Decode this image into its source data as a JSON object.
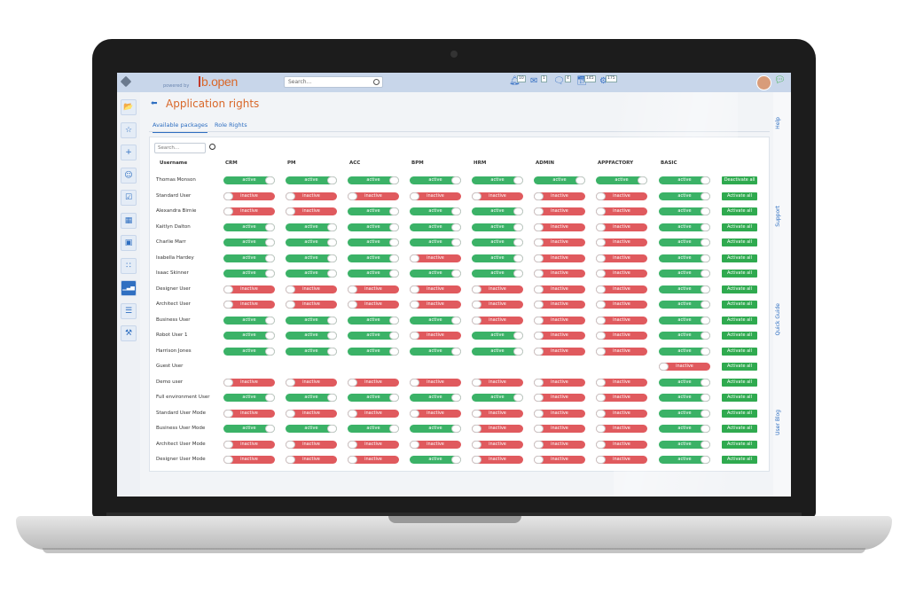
{
  "app": {
    "powered_by": "powered by",
    "brand": "b.open",
    "search_placeholder": "Search...",
    "badges": [
      "10",
      "1",
      "4",
      "145",
      "175"
    ]
  },
  "sidebar": {
    "icons": [
      "folder-icon",
      "star-icon",
      "plus-icon",
      "users-icon",
      "checkbox-icon",
      "grid-icon",
      "modules-icon",
      "apps-icon",
      "chart-icon",
      "org-chart-icon",
      "tools-icon"
    ],
    "active_index": 8
  },
  "page": {
    "back_label": "🡐",
    "title": "Application rights",
    "tabs": [
      "Available packages",
      "Role Rights"
    ],
    "user_search_placeholder": "Search..."
  },
  "table": {
    "username_header": "Username",
    "columns": [
      "CRM",
      "PM",
      "ACC",
      "BPM",
      "HRM",
      "ADMIN",
      "APPFACTORY",
      "BASIC"
    ],
    "on_label": "active",
    "off_label": "inactive",
    "rows": [
      {
        "user": "Thomas Monson",
        "states": [
          1,
          1,
          1,
          1,
          1,
          1,
          1,
          1
        ],
        "action": "Deactivate all"
      },
      {
        "user": "Standard User",
        "states": [
          0,
          0,
          0,
          0,
          0,
          0,
          0,
          1
        ],
        "action": "Activate all"
      },
      {
        "user": "Alexandra Birnie",
        "states": [
          0,
          0,
          1,
          1,
          1,
          0,
          0,
          1
        ],
        "action": "Activate all"
      },
      {
        "user": "Kaitlyn Dalton",
        "states": [
          1,
          1,
          1,
          1,
          1,
          0,
          0,
          1
        ],
        "action": "Activate all"
      },
      {
        "user": "Charlie Marr",
        "states": [
          1,
          1,
          1,
          1,
          1,
          0,
          0,
          1
        ],
        "action": "Activate all"
      },
      {
        "user": "Isabella Hardey",
        "states": [
          1,
          1,
          1,
          0,
          1,
          0,
          0,
          1
        ],
        "action": "Activate all"
      },
      {
        "user": "Isaac Skinner",
        "states": [
          1,
          1,
          1,
          1,
          1,
          0,
          0,
          1
        ],
        "action": "Activate all"
      },
      {
        "user": "Designer User",
        "states": [
          0,
          0,
          0,
          0,
          0,
          0,
          0,
          1
        ],
        "action": "Activate all"
      },
      {
        "user": "Architect User",
        "states": [
          0,
          0,
          0,
          0,
          0,
          0,
          0,
          1
        ],
        "action": "Activate all"
      },
      {
        "user": "Business User",
        "states": [
          1,
          1,
          1,
          1,
          0,
          0,
          0,
          1
        ],
        "action": "Activate all"
      },
      {
        "user": "Robot User 1",
        "states": [
          1,
          1,
          1,
          0,
          1,
          0,
          0,
          1
        ],
        "action": "Activate all"
      },
      {
        "user": "Harrison Jones",
        "states": [
          1,
          1,
          1,
          1,
          1,
          0,
          0,
          1
        ],
        "action": "Activate all"
      },
      {
        "user": "Guest User",
        "states": [
          null,
          null,
          null,
          null,
          null,
          null,
          null,
          0
        ],
        "action": "Activate all"
      },
      {
        "user": "Demo user",
        "states": [
          0,
          0,
          0,
          0,
          0,
          0,
          0,
          1
        ],
        "action": "Activate all"
      },
      {
        "user": "Full environment User",
        "states": [
          1,
          1,
          1,
          1,
          1,
          0,
          0,
          1
        ],
        "action": "Activate all"
      },
      {
        "user": "Standard User Mode",
        "states": [
          0,
          0,
          0,
          0,
          0,
          0,
          0,
          1
        ],
        "action": "Activate all"
      },
      {
        "user": "Business User Mode",
        "states": [
          1,
          1,
          1,
          1,
          0,
          0,
          0,
          1
        ],
        "action": "Activate all"
      },
      {
        "user": "Architect User Mode",
        "states": [
          0,
          0,
          0,
          0,
          0,
          0,
          0,
          1
        ],
        "action": "Activate all"
      },
      {
        "user": "Designer User Mode",
        "states": [
          0,
          0,
          0,
          1,
          0,
          0,
          0,
          1
        ],
        "action": "Activate all"
      }
    ]
  },
  "right_tabs": [
    "Help",
    "Support",
    "Quick Guide",
    "User Blog"
  ],
  "colors": {
    "active": "#3bb267",
    "inactive": "#e05a5e",
    "accent": "#2f6fc1",
    "title": "#d9682a"
  }
}
